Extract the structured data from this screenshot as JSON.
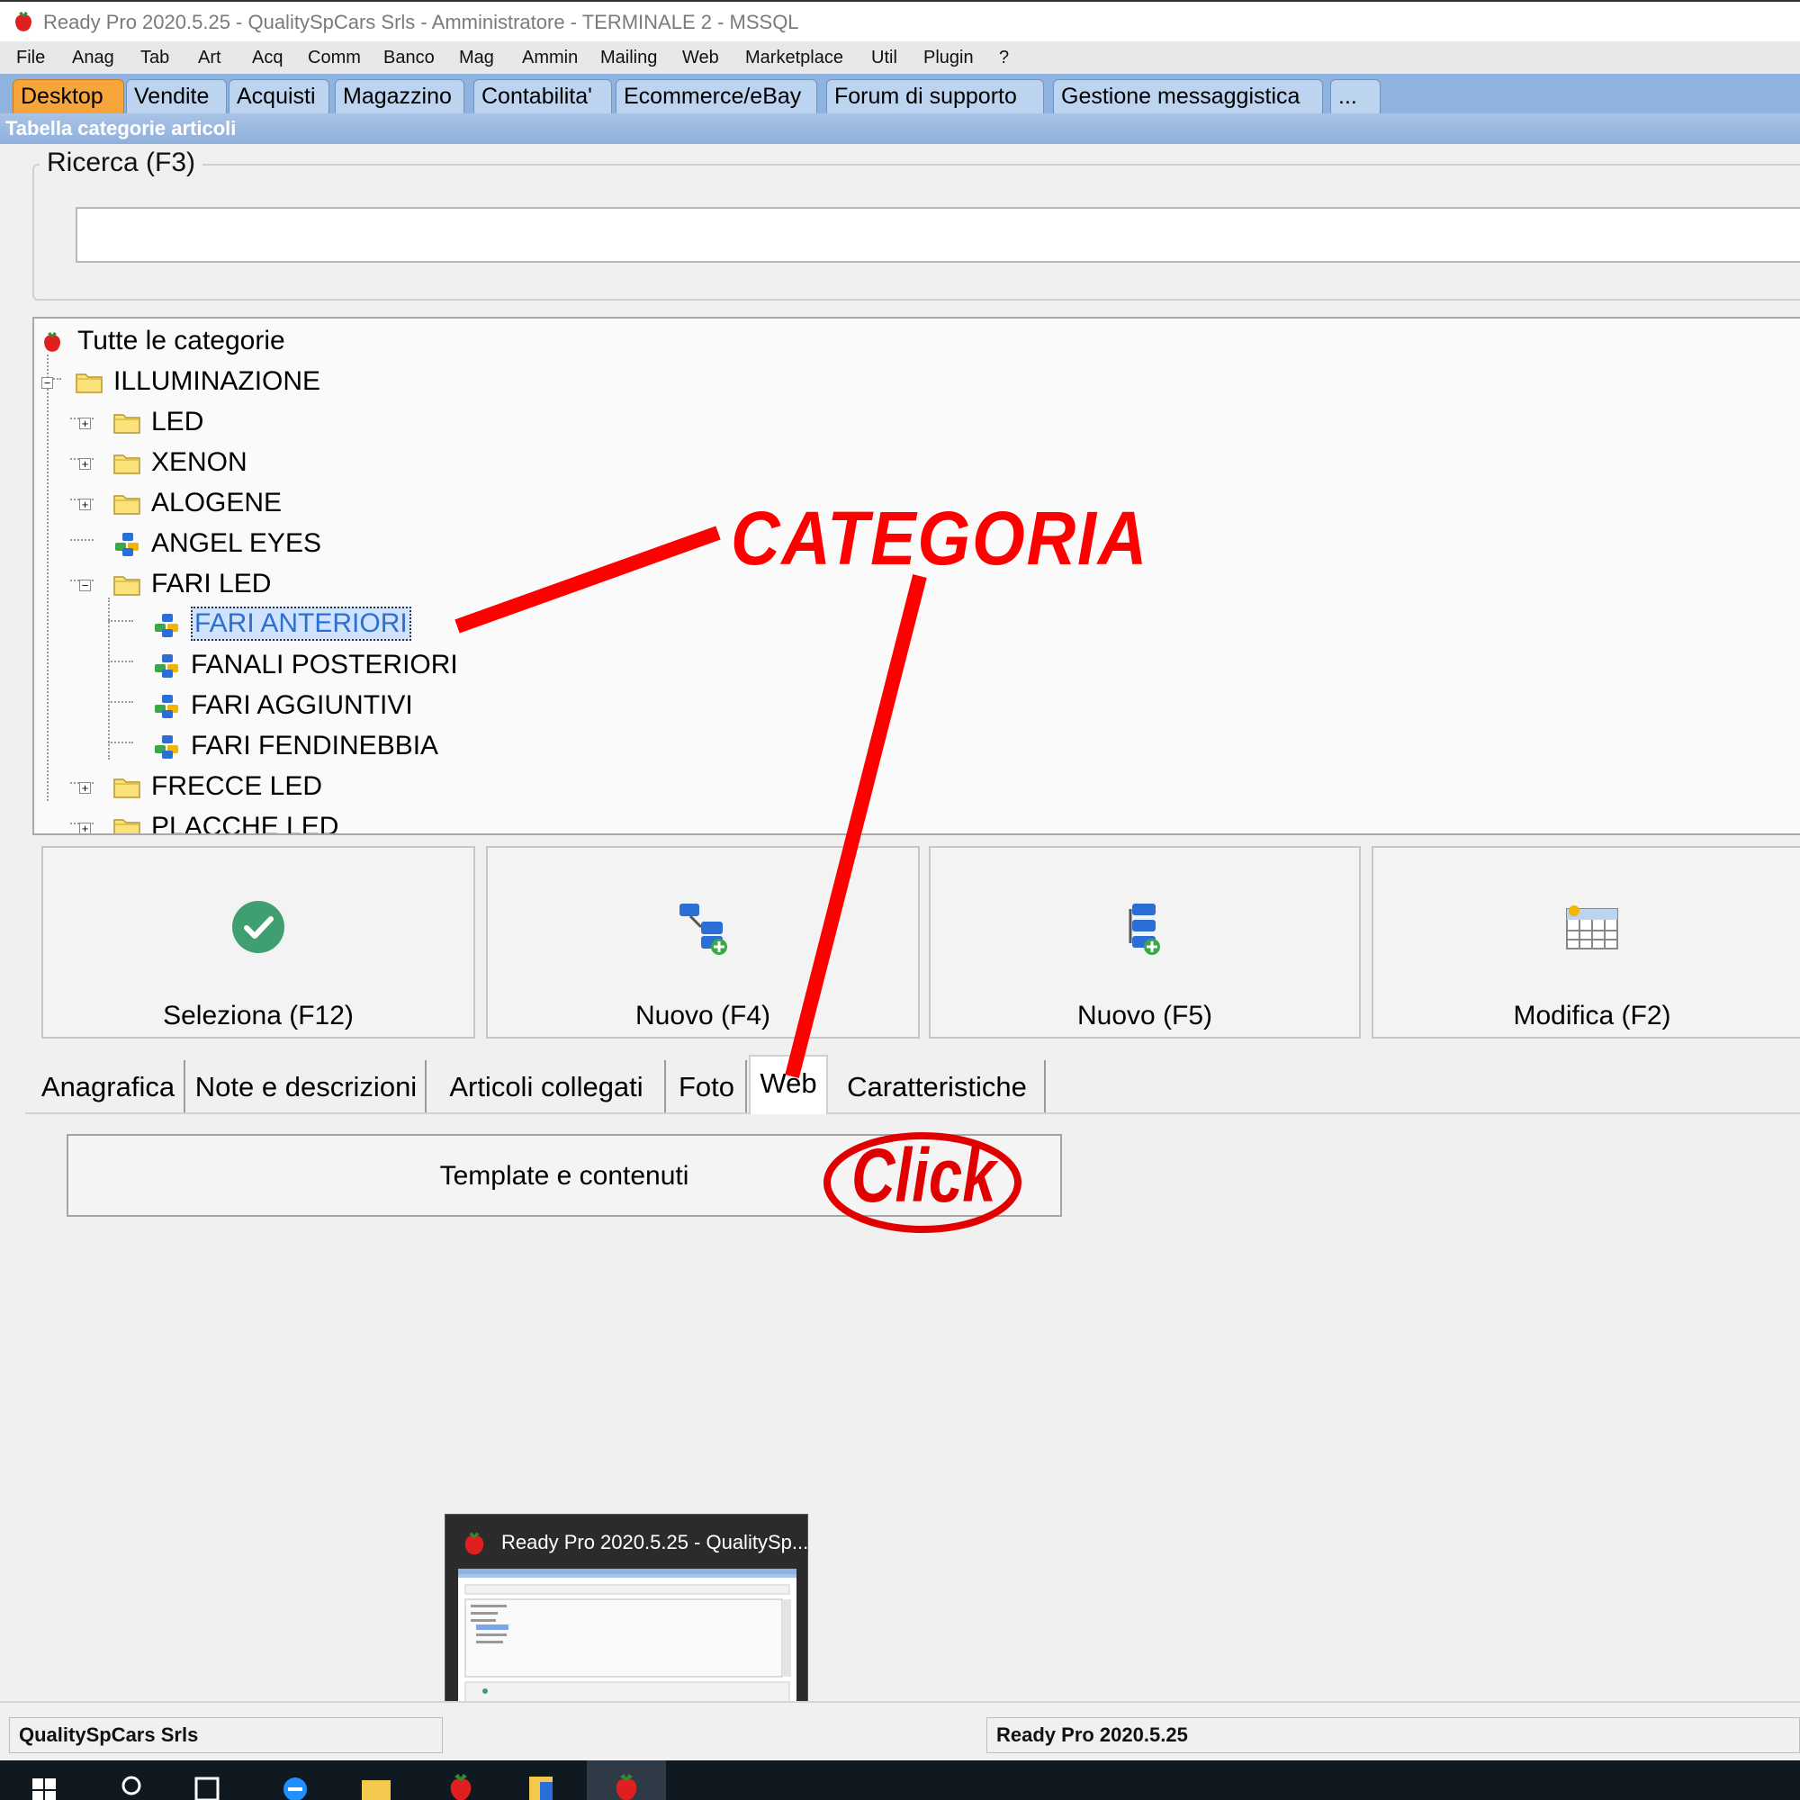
{
  "window": {
    "title": "Ready Pro 2020.5.25 - QualitySpCars Srls - Amministratore - TERMINALE 2 - MSSQL"
  },
  "menu": [
    "File",
    "Anag",
    "Tab",
    "Art",
    "Acq",
    "Comm",
    "Banco",
    "Mag",
    "Ammin",
    "Mailing",
    "Web",
    "Marketplace",
    "Util",
    "Plugin",
    "?"
  ],
  "ribbon_tabs": [
    "Desktop",
    "Vendite",
    "Acquisti",
    "Magazzino",
    "Contabilita'",
    "Ecommerce/eBay",
    "Forum di supporto",
    "Gestione messaggistica",
    "..."
  ],
  "ribbon_active": "Desktop",
  "caption": "Tabella categorie articoli",
  "search": {
    "label": "Ricerca (F3)",
    "value": ""
  },
  "tree": {
    "root": "Tutte le categorie",
    "nodes": [
      {
        "label": "ILLUMINAZIONE",
        "icon": "folder-icon",
        "expander": "−"
      },
      {
        "label": "LED",
        "icon": "folder-icon",
        "expander": "+"
      },
      {
        "label": "XENON",
        "icon": "folder-icon",
        "expander": "+"
      },
      {
        "label": "ALOGENE",
        "icon": "folder-icon",
        "expander": "+"
      },
      {
        "label": "ANGEL EYES",
        "icon": "category-icon",
        "expander": ""
      },
      {
        "label": "FARI LED",
        "icon": "folder-icon",
        "expander": "−"
      },
      {
        "label": "FARI ANTERIORI",
        "icon": "category-icon",
        "expander": "",
        "selected": true
      },
      {
        "label": "FANALI POSTERIORI",
        "icon": "category-icon",
        "expander": ""
      },
      {
        "label": "FARI AGGIUNTIVI",
        "icon": "category-icon",
        "expander": ""
      },
      {
        "label": "FARI FENDINEBBIA",
        "icon": "category-icon",
        "expander": ""
      },
      {
        "label": "FRECCE LED",
        "icon": "folder-icon",
        "expander": "+"
      },
      {
        "label": "PLACCHE LED",
        "icon": "folder-icon",
        "expander": "+"
      }
    ]
  },
  "buttons": {
    "select": "Seleziona (F12)",
    "new_f4": "Nuovo (F4)",
    "new_f5": "Nuovo (F5)",
    "edit": "Modifica (F2)"
  },
  "detail_tabs": [
    "Anagrafica",
    "Note e descrizioni",
    "Articoli collegati",
    "Foto",
    "Web",
    "Caratteristiche"
  ],
  "detail_active": "Web",
  "template_button": "Template e contenuti",
  "annotations": {
    "category": "CATEGORIA",
    "click": "Click",
    "color": "#ff0000"
  },
  "thumbnail": {
    "title": "Ready Pro 2020.5.25 - QualitySp..."
  },
  "status": {
    "company": "QualitySpCars Srls",
    "version": "Ready Pro 2020.5.25"
  },
  "colors": {
    "ribbon": "#8fb3df",
    "active_tab": "#f6a53a",
    "selection": "#cfe3ff"
  }
}
